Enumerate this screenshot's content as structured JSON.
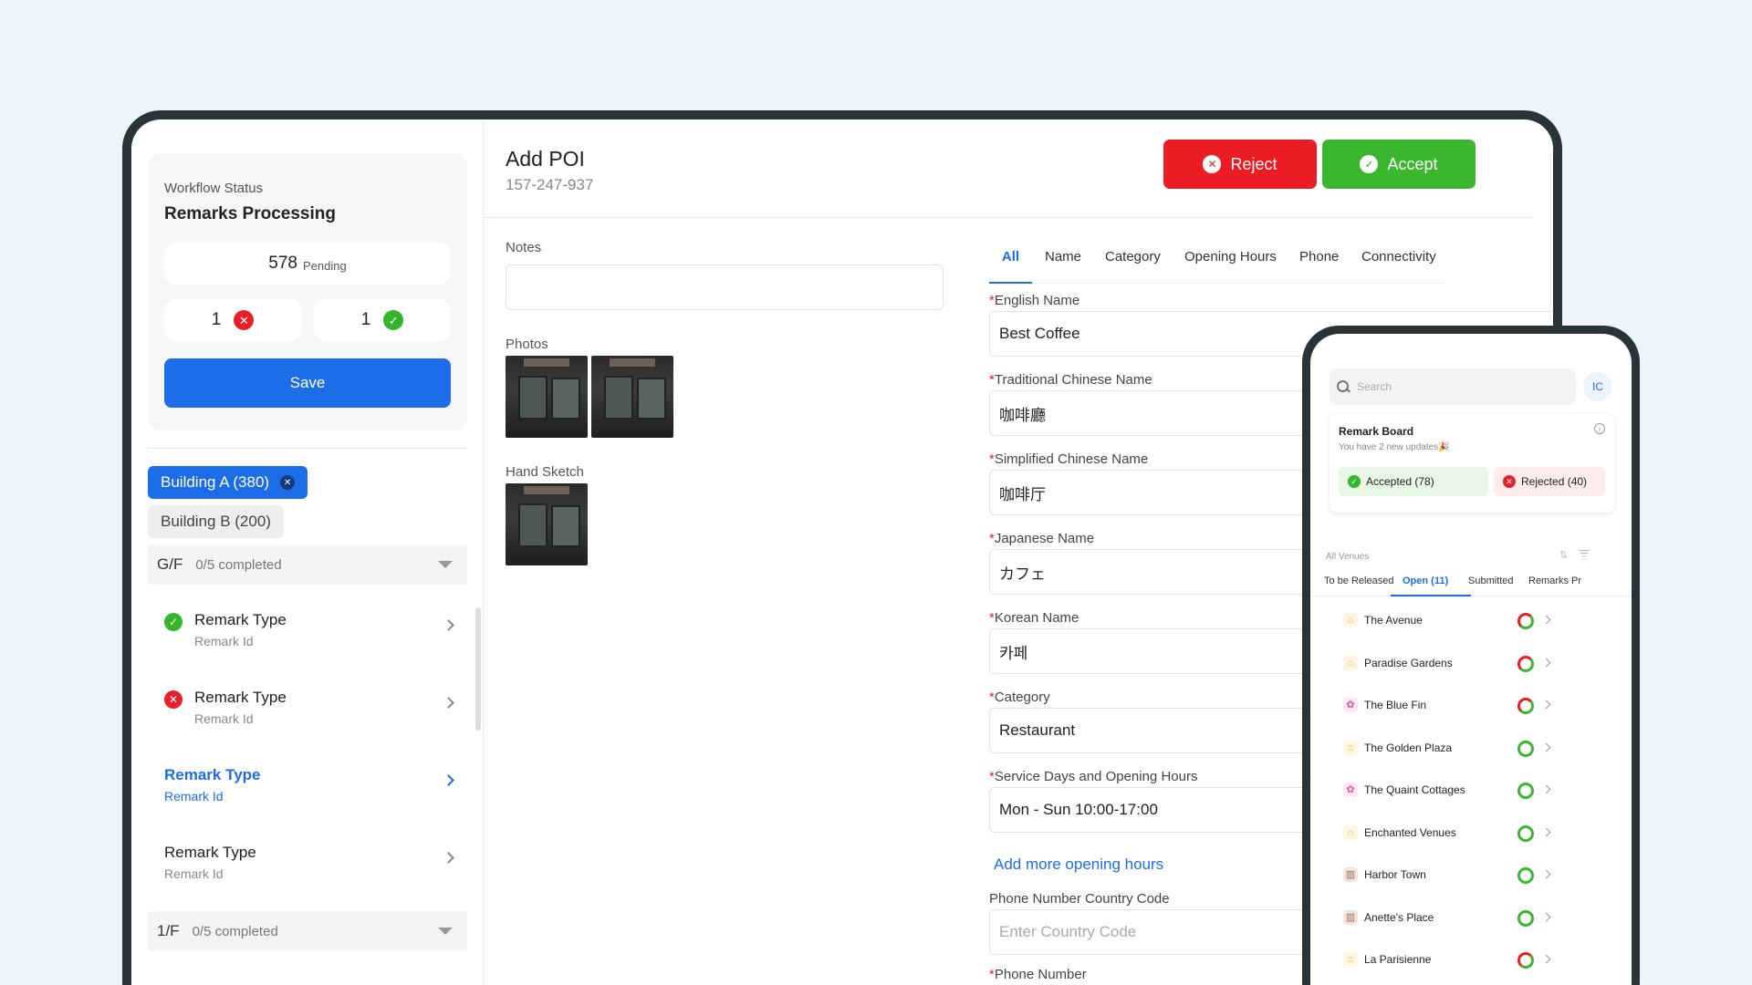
{
  "workflow": {
    "label": "Workflow Status",
    "title": "Remarks Processing",
    "pending_count": "578",
    "pending_label": "Pending",
    "rejected_count": "1",
    "accepted_count": "1",
    "save_label": "Save"
  },
  "buildings": [
    {
      "label": "Building A (380)",
      "active": true
    },
    {
      "label": "Building B (200)",
      "active": false
    }
  ],
  "floors": [
    {
      "name": "G/F",
      "progress": "0/5 completed"
    },
    {
      "name": "1/F",
      "progress": "0/5 completed"
    }
  ],
  "remarks": [
    {
      "title": "Remark Type",
      "sub": "Remark Id",
      "status": "accepted"
    },
    {
      "title": "Remark Type",
      "sub": "Remark Id",
      "status": "rejected"
    },
    {
      "title": "Remark Type",
      "sub": "Remark Id",
      "status": "active"
    },
    {
      "title": "Remark Type",
      "sub": "Remark Id",
      "status": "none"
    }
  ],
  "header": {
    "title": "Add POI",
    "id": "157-247-937",
    "reject_label": "Reject",
    "accept_label": "Accept"
  },
  "left_form": {
    "notes_label": "Notes",
    "photos_label": "Photos",
    "sketch_label": "Hand Sketch"
  },
  "tabs": [
    "All",
    "Name",
    "Category",
    "Opening Hours",
    "Phone",
    "Connectivity"
  ],
  "fields": [
    {
      "label": "English Name",
      "required": true,
      "value": "Best Coffee"
    },
    {
      "label": "Traditional Chinese Name",
      "required": true,
      "value": "咖啡廳"
    },
    {
      "label": "Simplified Chinese Name",
      "required": true,
      "value": "咖啡厅"
    },
    {
      "label": "Japanese Name",
      "required": true,
      "value": "カフェ"
    },
    {
      "label": "Korean Name",
      "required": true,
      "value": "카페"
    },
    {
      "label": "Category",
      "required": true,
      "value": "Restaurant"
    },
    {
      "label": "Service Days and Opening Hours",
      "required": true,
      "value": "Mon - Sun 10:00-17:00"
    }
  ],
  "add_hours_label": "Add more opening hours",
  "phone_country": {
    "label": "Phone Number Country Code",
    "placeholder": "Enter Country Code"
  },
  "phone_number_label": "Phone Number",
  "mobile": {
    "search_placeholder": "Search",
    "avatar": "IC",
    "board_title": "Remark Board",
    "board_sub": "You have 2 new updates🎉",
    "accepted_label": "Accepted (78)",
    "rejected_label": "Rejected (40)",
    "all_venues": "All Venues",
    "tabs": [
      "To be Released",
      "Open (11)",
      "Submitted",
      "Remarks Pr"
    ],
    "venues": [
      {
        "name": "The Avenue",
        "icon": "building-icon",
        "ring_top": "#ec1c24",
        "ring_bottom": "#3cb52f"
      },
      {
        "name": "Paradise Gardens",
        "icon": "building-icon",
        "ring_top": "#ec1c24",
        "ring_bottom": "#3cb52f"
      },
      {
        "name": "The Blue Fin",
        "icon": "flower-icon",
        "ring_top": "#ec1c24",
        "ring_bottom": "#3cb52f"
      },
      {
        "name": "The Golden Plaza",
        "icon": "building-icon",
        "ring_top": "#3cb52f",
        "ring_bottom": "#3cb52f"
      },
      {
        "name": "The Quaint Cottages",
        "icon": "flower-icon",
        "ring_top": "#3cb52f",
        "ring_bottom": "#3cb52f"
      },
      {
        "name": "Enchanted Venues",
        "icon": "building-icon",
        "ring_top": "#3cb52f",
        "ring_bottom": "#3cb52f"
      },
      {
        "name": "Harbor Town",
        "icon": "office-icon",
        "ring_top": "#3cb52f",
        "ring_bottom": "#3cb52f"
      },
      {
        "name": "Anette's Place",
        "icon": "office-icon",
        "ring_top": "#3cb52f",
        "ring_bottom": "#3cb52f"
      },
      {
        "name": "La Parisienne",
        "icon": "building-icon",
        "ring_top": "#ec1c24",
        "ring_bottom": "#3cb52f"
      }
    ]
  },
  "colors": {
    "primary": "#1e6de8",
    "reject": "#ec1c24",
    "accept": "#3cb52f",
    "background": "#eef5fc",
    "device_frame": "#2b3434"
  }
}
